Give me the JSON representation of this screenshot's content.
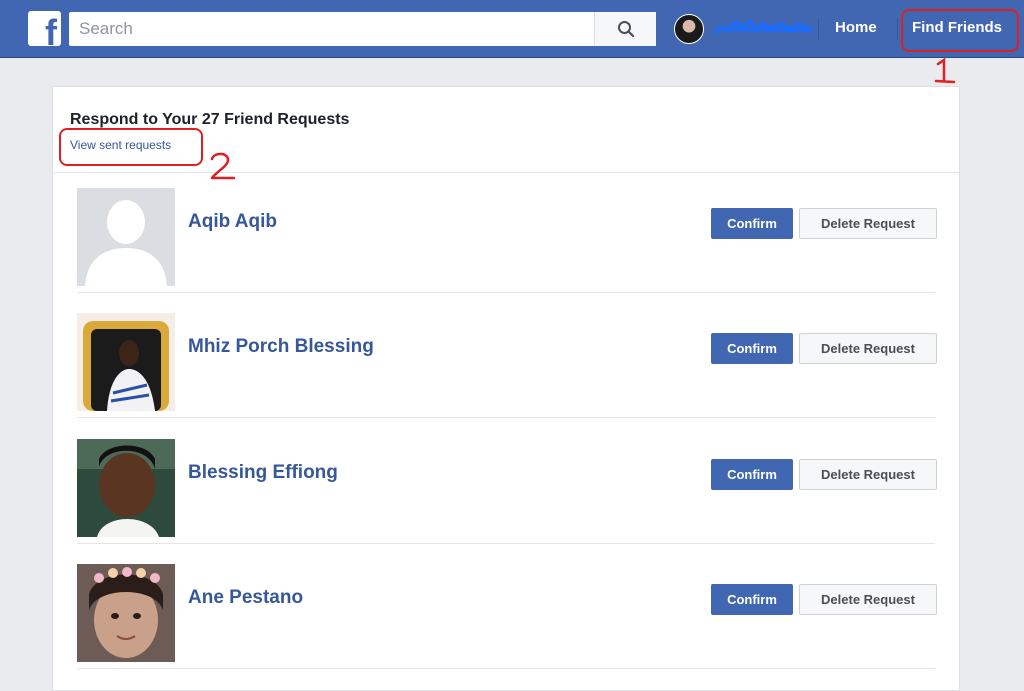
{
  "header": {
    "logo_letter": "f",
    "search_placeholder": "Search",
    "profile_name": "Ucheehsitinds",
    "nav": {
      "home": "Home",
      "find_friends": "Find Friends"
    }
  },
  "requests_panel": {
    "title": "Respond to Your 27 Friend Requests",
    "view_sent_link": "View sent requests",
    "confirm_label": "Confirm",
    "delete_label": "Delete Request",
    "requests": [
      {
        "name": "Aqib Aqib",
        "photo": "default-silhouette"
      },
      {
        "name": "Mhiz Porch Blessing",
        "photo": "woman-gold-chair"
      },
      {
        "name": "Blessing Effiong",
        "photo": "woman-selfie"
      },
      {
        "name": "Ane Pestano",
        "photo": "girl-flower-crown"
      }
    ]
  },
  "annotations": {
    "marker_1": "1",
    "marker_2": "2",
    "color": "#e02020"
  },
  "colors": {
    "brand": "#4267b2",
    "link": "#365899",
    "background": "#e9ebee"
  }
}
